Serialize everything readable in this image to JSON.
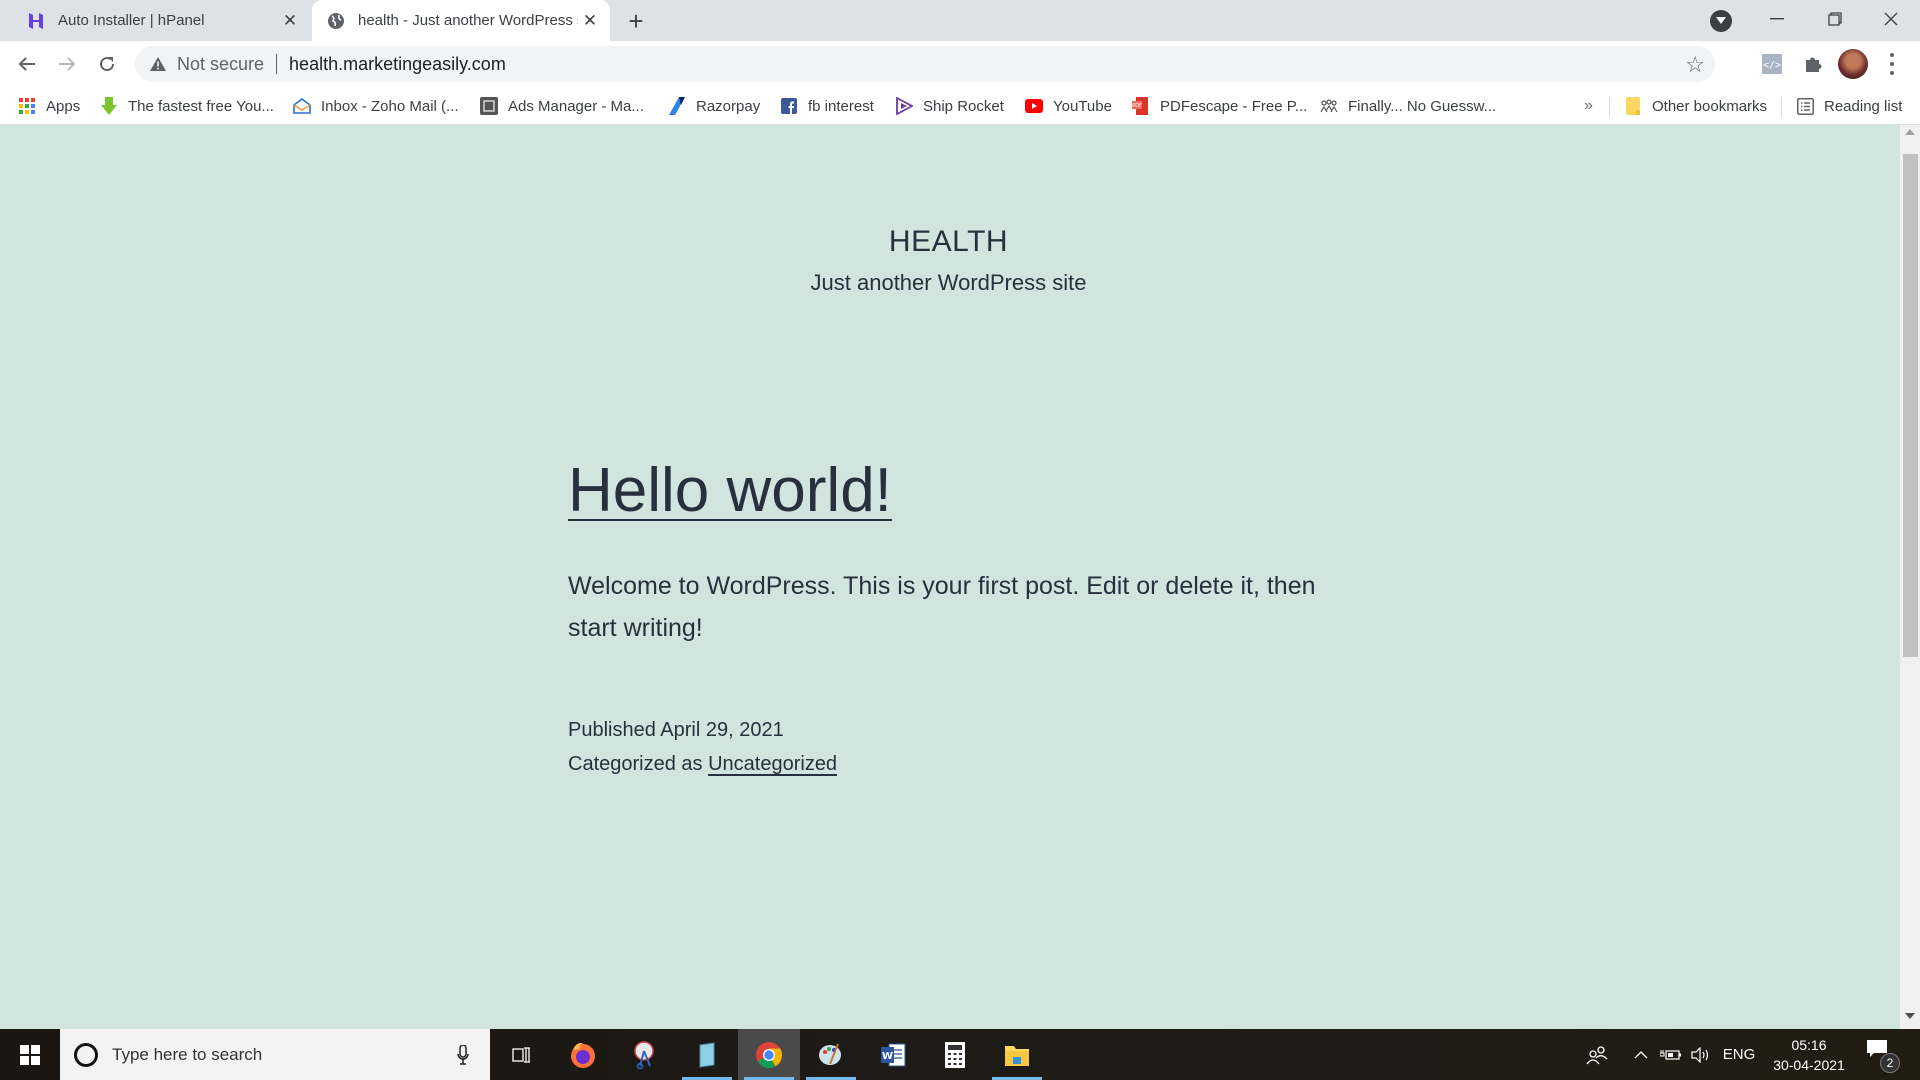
{
  "browser": {
    "tabs": [
      {
        "title": "Auto Installer | hPanel",
        "icon": "hostinger-icon",
        "active": false
      },
      {
        "title": "health - Just another WordPress site",
        "icon": "globe-icon",
        "active": true
      }
    ],
    "new_tab_label": "+",
    "address_bar": {
      "security_label": "Not secure",
      "url": "health.marketingeasily.com"
    },
    "bookmarks": [
      {
        "label": "Apps",
        "icon": "apps-grid-icon"
      },
      {
        "label": "The fastest free You...",
        "icon": "download-arrow-icon"
      },
      {
        "label": "Inbox - Zoho Mail (...",
        "icon": "zoho-mail-icon"
      },
      {
        "label": "Ads Manager - Ma...",
        "icon": "ads-manager-icon"
      },
      {
        "label": "Razorpay",
        "icon": "razorpay-icon"
      },
      {
        "label": "fb interest",
        "icon": "facebook-icon"
      },
      {
        "label": "Ship Rocket",
        "icon": "shiprocket-icon"
      },
      {
        "label": "YouTube",
        "icon": "youtube-icon"
      },
      {
        "label": "PDFescape - Free P...",
        "icon": "pdf-icon"
      },
      {
        "label": "Finally... No Guessw...",
        "icon": "people-icon"
      }
    ],
    "bookmarks_overflow": "»",
    "other_bookmarks": "Other bookmarks",
    "reading_list": "Reading list"
  },
  "page": {
    "site_title": "HEALTH",
    "site_description": "Just another WordPress site",
    "post": {
      "title": "Hello world!",
      "body": "Welcome to WordPress. This is your first post. Edit or delete it, then start writing!",
      "published_label": "Published",
      "published_date": "April 29, 2021",
      "categorized_label": "Categorized as",
      "category": "Uncategorized"
    },
    "colors": {
      "background": "#d1e4dd",
      "text": "#28303d"
    }
  },
  "taskbar": {
    "search_placeholder": "Type here to search",
    "apps": [
      "task-view",
      "firefox",
      "snipping-tool",
      "notepad",
      "chrome",
      "paint",
      "word",
      "calculator",
      "file-explorer"
    ],
    "language": "ENG",
    "time": "05:16",
    "date": "30-04-2021",
    "notification_count": "2"
  }
}
